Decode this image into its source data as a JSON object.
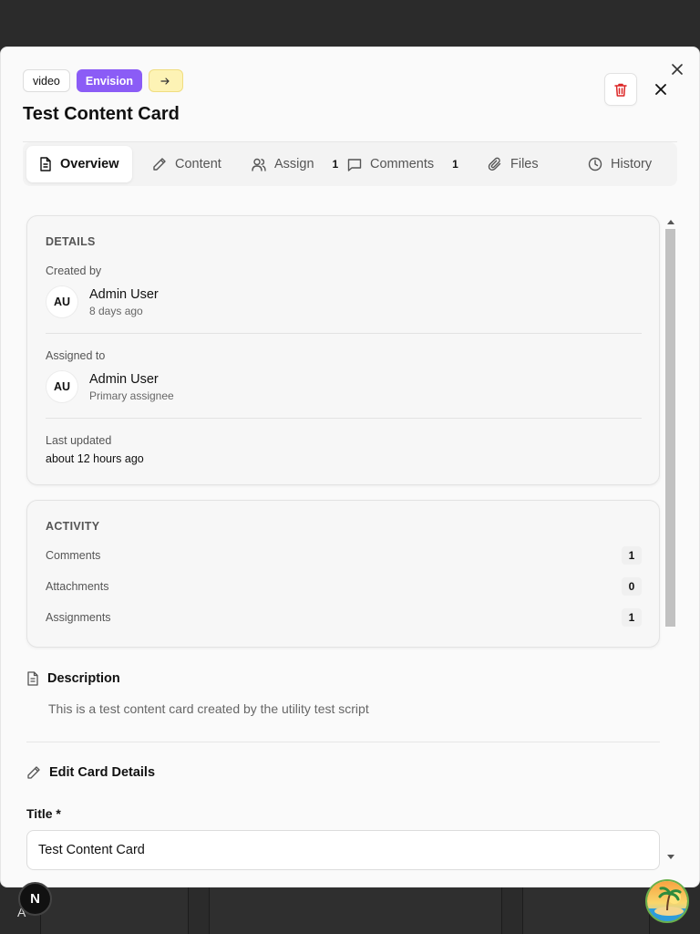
{
  "header": {
    "badges": [
      {
        "label": "video"
      },
      {
        "label": "Envision"
      },
      {
        "label": "→",
        "icon": "arrow-right-icon"
      }
    ],
    "title": "Test Content Card",
    "accent_color": "#8b5cf6",
    "danger_color": "#dc2626"
  },
  "tabs": [
    {
      "label": "Overview",
      "icon": "file-text-icon",
      "active": true
    },
    {
      "label": "Content",
      "icon": "pencil-icon"
    },
    {
      "label": "Assign",
      "icon": "users-icon",
      "count": "1"
    },
    {
      "label": "Comments",
      "icon": "message-square-icon",
      "count": "1"
    },
    {
      "label": "Files",
      "icon": "paperclip-icon"
    },
    {
      "label": "History",
      "icon": "clock-icon"
    }
  ],
  "details": {
    "heading": "DETAILS",
    "created_by_label": "Created by",
    "creator": {
      "initials": "AU",
      "name": "Admin User",
      "sub": "8 days ago"
    },
    "assigned_to_label": "Assigned to",
    "assignee": {
      "initials": "AU",
      "name": "Admin User",
      "sub": "Primary assignee"
    },
    "last_updated_label": "Last updated",
    "last_updated_value": "about 12 hours ago"
  },
  "activity": {
    "heading": "ACTIVITY",
    "rows": [
      {
        "label": "Comments",
        "count": "1"
      },
      {
        "label": "Attachments",
        "count": "0"
      },
      {
        "label": "Assignments",
        "count": "1"
      }
    ]
  },
  "description": {
    "title": "Description",
    "text": "This is a test content card created by the utility test script"
  },
  "edit": {
    "title": "Edit Card Details",
    "title_field_label": "Title *",
    "title_field_value": "Test Content Card"
  },
  "overlay": {
    "next_badge": "N"
  }
}
